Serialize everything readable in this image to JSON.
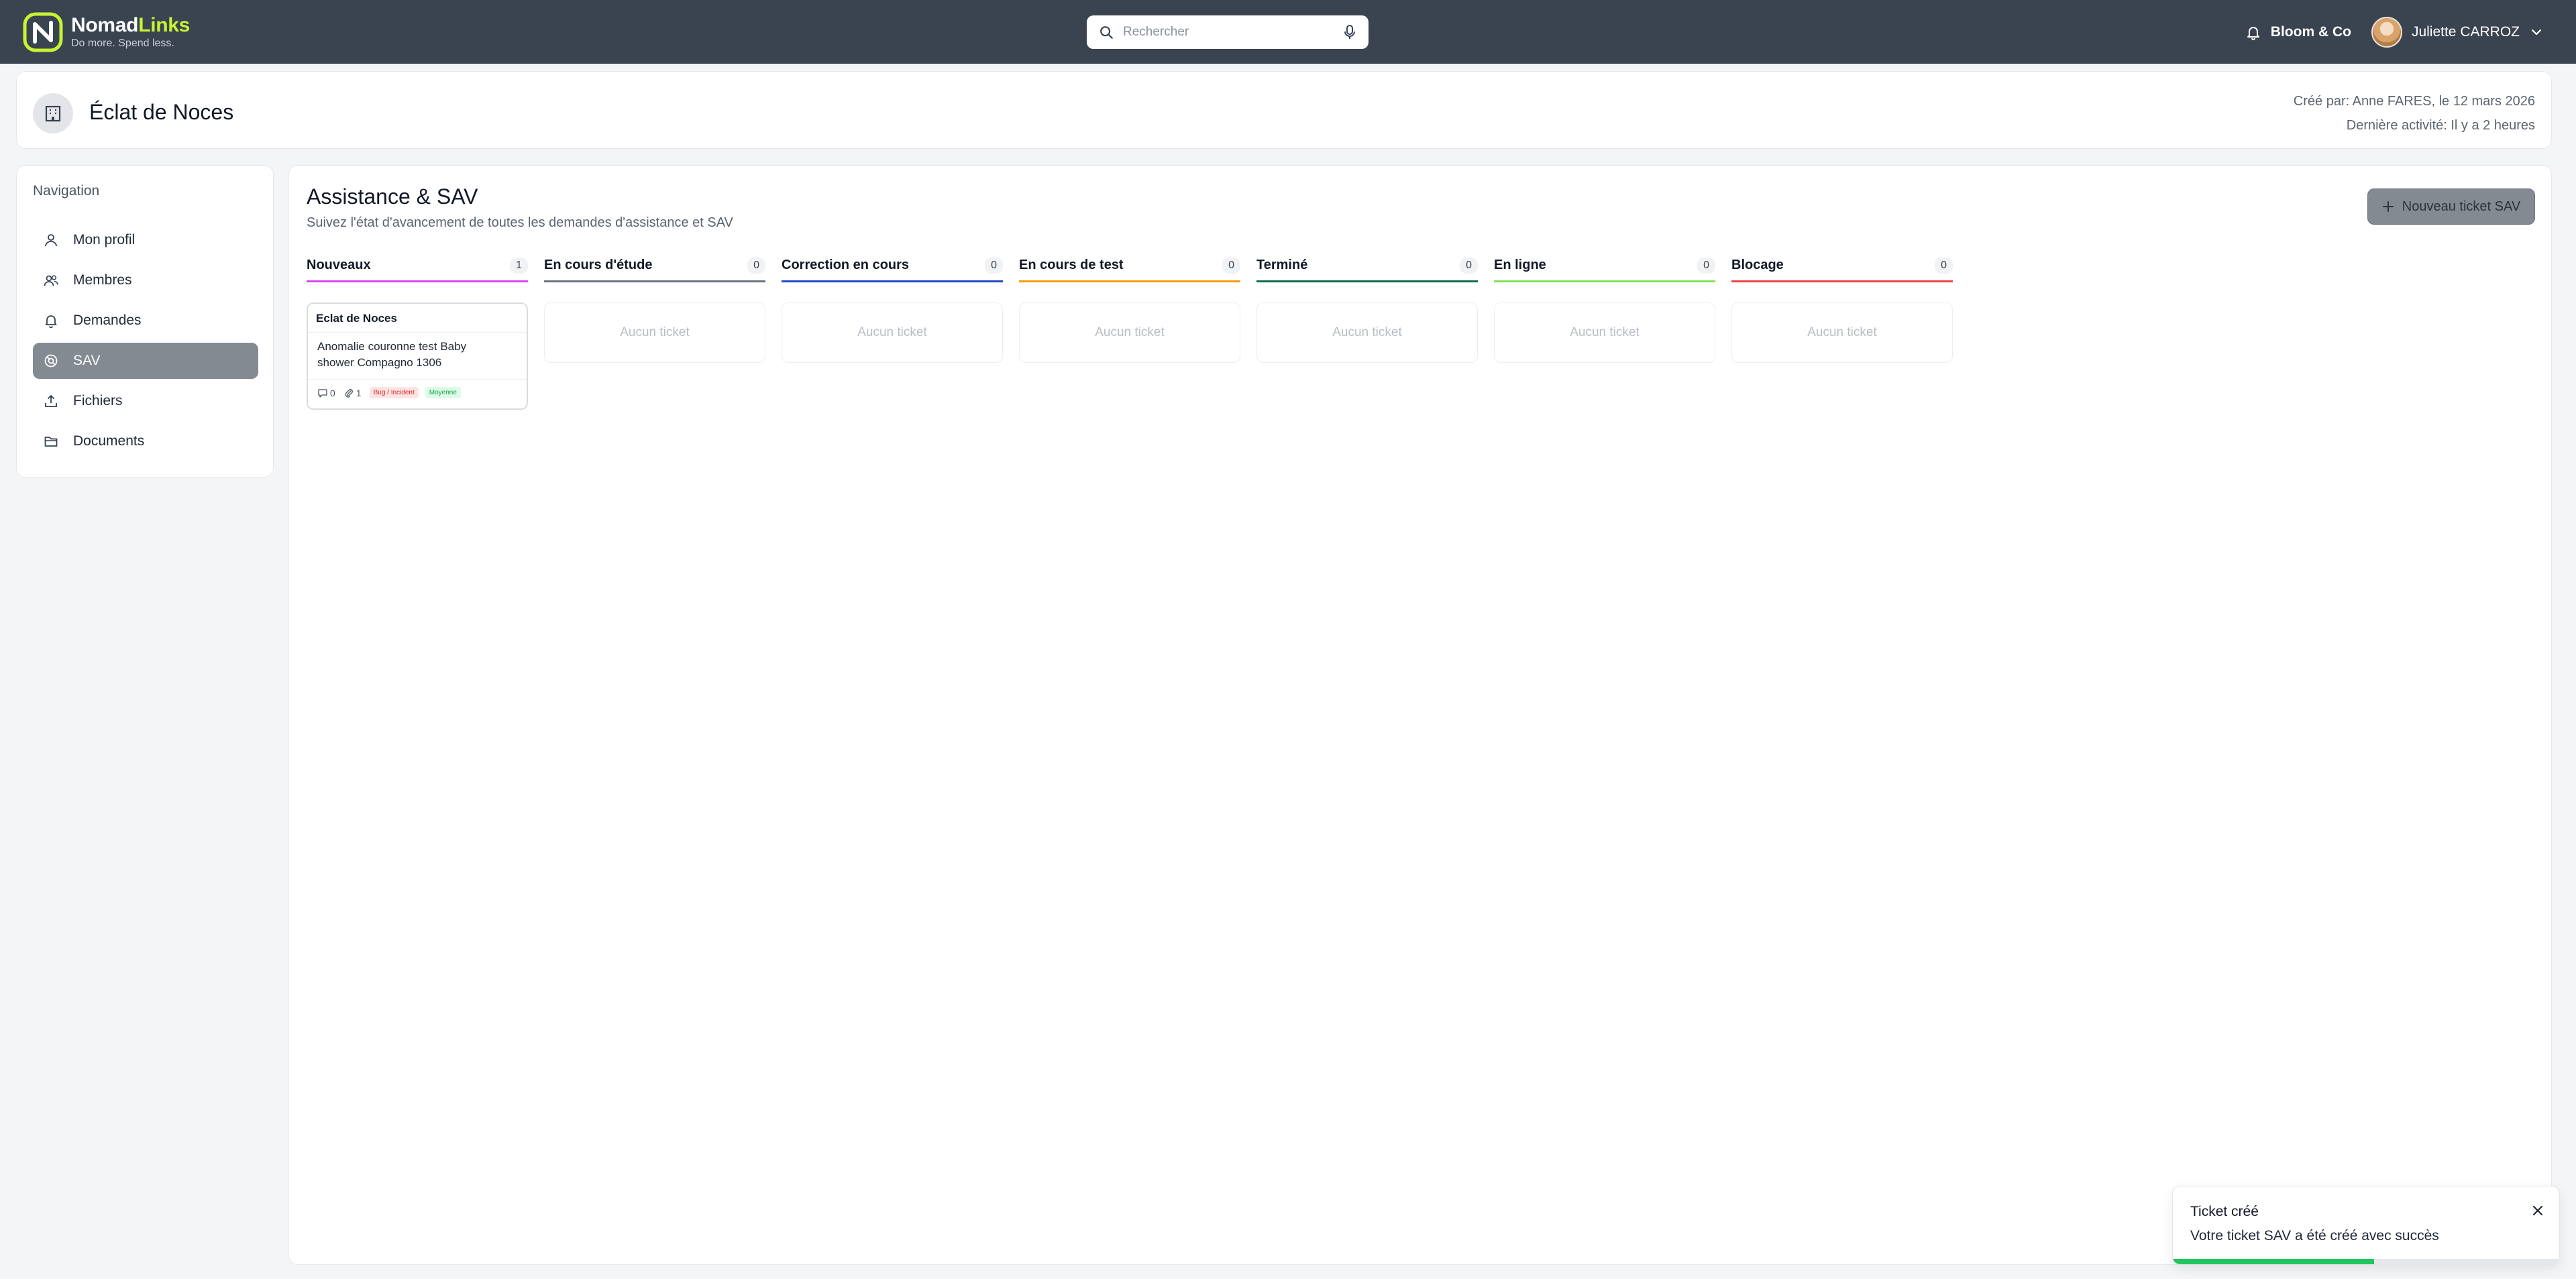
{
  "topbar": {
    "logo_name_main": "Nomad",
    "logo_name_accent": "Links",
    "logo_tagline": "Do more. Spend less.",
    "search_placeholder": "Rechercher",
    "org_name": "Bloom & Co",
    "user_name": "Juliette CARROZ"
  },
  "header": {
    "project_title": "Éclat de Noces",
    "created_by": "Créé par: Anne FARES, le 12 mars 2026",
    "last_activity": "Dernière activité: Il y a 2 heures"
  },
  "sidebar": {
    "title": "Navigation",
    "items": [
      {
        "label": "Mon profil",
        "icon": "user-icon",
        "active": false
      },
      {
        "label": "Membres",
        "icon": "users-icon",
        "active": false
      },
      {
        "label": "Demandes",
        "icon": "bell-icon",
        "active": false
      },
      {
        "label": "SAV",
        "icon": "support-icon",
        "active": true
      },
      {
        "label": "Fichiers",
        "icon": "upload-icon",
        "active": false
      },
      {
        "label": "Documents",
        "icon": "folder-icon",
        "active": false
      }
    ]
  },
  "main": {
    "title": "Assistance & SAV",
    "subtitle": "Suivez l'état d'avancement de toutes les demandes d'assistance et SAV",
    "new_button_label": "Nouveau ticket SAV",
    "empty_label": "Aucun ticket",
    "columns": [
      {
        "title": "Nouveaux",
        "count": "1",
        "color": "#d946ef"
      },
      {
        "title": "En cours d'étude",
        "count": "0",
        "color": "#6b7280"
      },
      {
        "title": "Correction en cours",
        "count": "0",
        "color": "#2546c7"
      },
      {
        "title": "En cours de test",
        "count": "0",
        "color": "#f59e0b"
      },
      {
        "title": "Terminé",
        "count": "0",
        "color": "#0f6b4f"
      },
      {
        "title": "En ligne",
        "count": "0",
        "color": "#7ee35a"
      },
      {
        "title": "Blocage",
        "count": "0",
        "color": "#ef4444"
      }
    ],
    "ticket": {
      "project": "Eclat de Noces",
      "title": "Anomalie couronne test Baby shower Compagno 1306",
      "comments": "0",
      "attachments": "1",
      "type_badge": "Bug / Incident",
      "priority_badge": "Moyenne"
    }
  },
  "toast": {
    "title": "Ticket créé",
    "message": "Votre ticket SAV a été créé avec succès",
    "progress": 0.52
  },
  "colors": {
    "topbar_bg": "#3a4451",
    "logo_accent": "#c6f432",
    "active_nav_bg": "#848a92",
    "toast_progress": "#22c55e"
  }
}
